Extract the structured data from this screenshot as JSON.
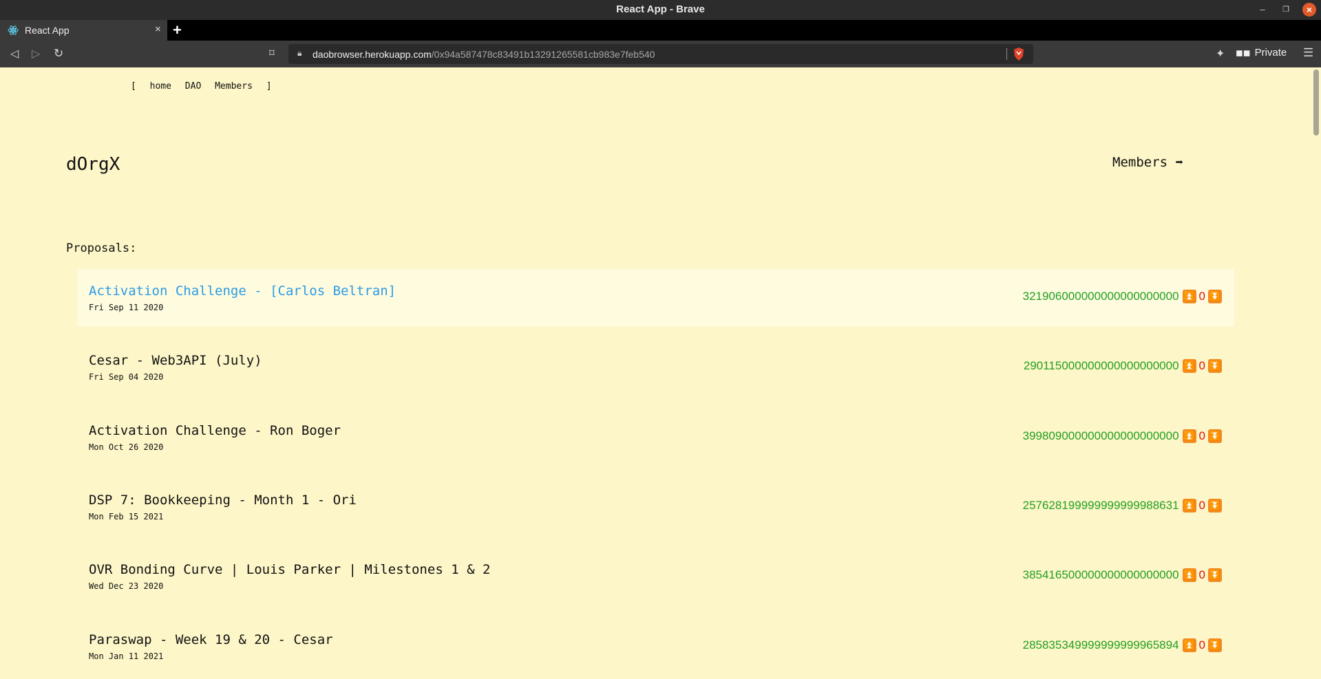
{
  "window": {
    "title": "React App - Brave"
  },
  "tab": {
    "label": "React App"
  },
  "toolbar": {
    "url_host": "daobrowser.herokuapp.com",
    "url_path": "/0x94a587478c83491b13291265581cb983e7feb540",
    "private_label": "Private"
  },
  "page": {
    "nav": {
      "open_bracket": "[",
      "home": "home",
      "dao": "DAO",
      "members": "Members",
      "close_bracket": "]"
    },
    "dao_name": "dOrgX",
    "members_link": "Members ➡",
    "proposals_label": "Proposals:",
    "proposals": [
      {
        "title": "Activation Challenge - [Carlos Beltran]",
        "date": "Fri Sep 11 2020",
        "amount": "321906000000000000000000",
        "votes": "0",
        "highlighted": true
      },
      {
        "title": "Cesar - Web3API (July)",
        "date": "Fri Sep 04 2020",
        "amount": "290115000000000000000000",
        "votes": "0",
        "highlighted": false
      },
      {
        "title": "Activation Challenge - Ron Boger",
        "date": "Mon Oct 26 2020",
        "amount": "399809000000000000000000",
        "votes": "0",
        "highlighted": false
      },
      {
        "title": "DSP 7: Bookkeeping - Month 1 - Ori",
        "date": "Mon Feb 15 2021",
        "amount": "257628199999999999988631",
        "votes": "0",
        "highlighted": false
      },
      {
        "title": "OVR Bonding Curve | Louis Parker | Milestones 1 & 2",
        "date": "Wed Dec 23 2020",
        "amount": "385416500000000000000000",
        "votes": "0",
        "highlighted": false
      },
      {
        "title": "Paraswap - Week 19 & 20 - Cesar",
        "date": "Mon Jan 11 2021",
        "amount": "285835349999999999965894",
        "votes": "0",
        "highlighted": false
      }
    ]
  },
  "icons": {
    "upvote": "up-arrow-icon",
    "downvote": "down-arrow-icon"
  },
  "colors": {
    "page_background": "#fdf6c8",
    "highlight_row": "#fefbdf",
    "link_blue": "#2b9be6",
    "amount_green": "#22a022",
    "vote_red": "#e01010",
    "vote_button": "#f18a1f"
  }
}
